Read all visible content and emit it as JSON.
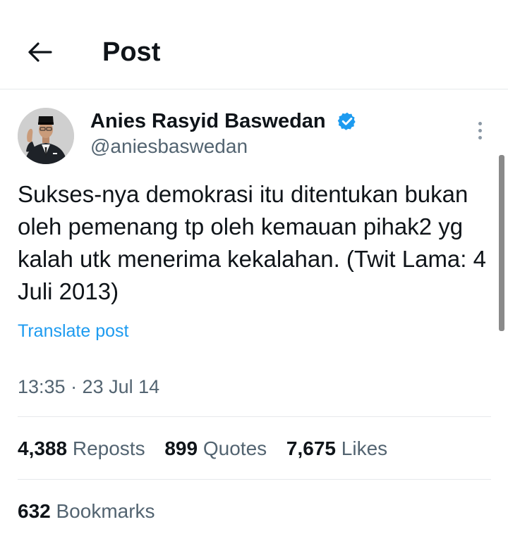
{
  "header": {
    "title": "Post",
    "back_icon": "arrow-left-icon"
  },
  "author": {
    "name": "Anies Rasyid Baswedan",
    "handle": "@aniesbaswedan",
    "verified_icon": "verified-badge-icon",
    "verified_color": "#1d9bf0"
  },
  "post": {
    "text": "Sukses-nya demokrasi itu ditentukan bukan oleh pemenang tp oleh kemauan pihak2 yg kalah utk menerima kekalahan. (Twit Lama: 4 Juli 2013)",
    "translate_label": "Translate post",
    "timestamp": "13:35 · 23 Jul 14"
  },
  "stats": {
    "reposts_count": "4,388",
    "reposts_label": "Reposts",
    "quotes_count": "899",
    "quotes_label": "Quotes",
    "likes_count": "7,675",
    "likes_label": "Likes",
    "bookmarks_count": "632",
    "bookmarks_label": "Bookmarks"
  },
  "colors": {
    "accent": "#1d9bf0",
    "text": "#0f1419",
    "secondary_text": "#536471",
    "divider": "#e6e9eb"
  }
}
